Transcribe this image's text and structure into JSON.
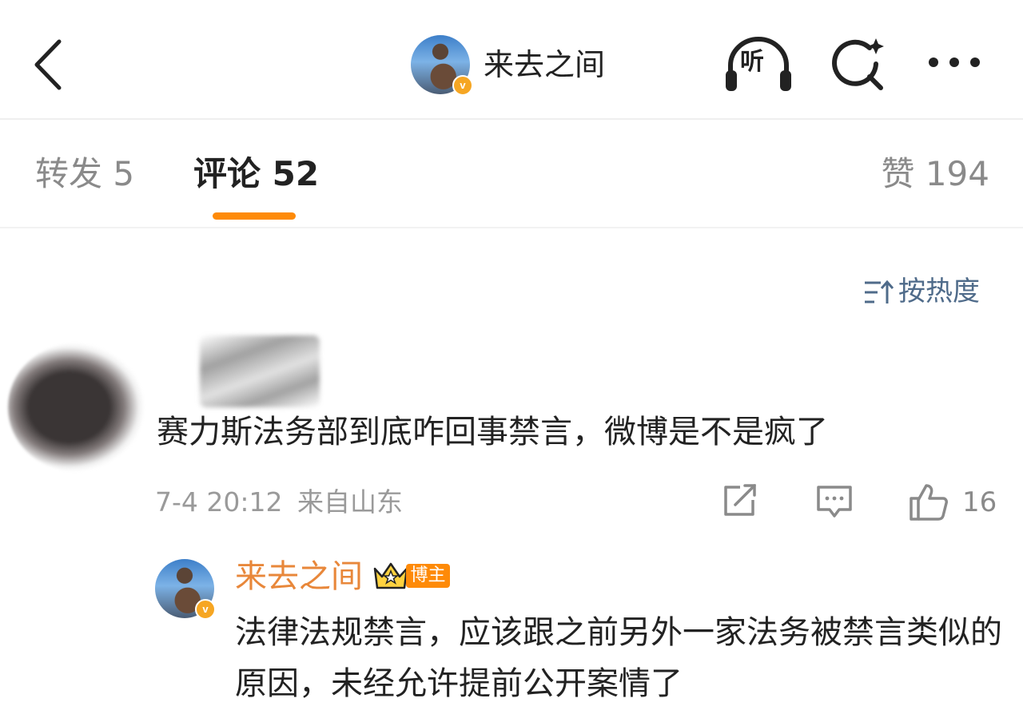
{
  "header": {
    "title": "来去之间",
    "listen_label": "听",
    "verified_badge": "v"
  },
  "tabs": [
    {
      "label": "转发 5"
    },
    {
      "label": "评论 52"
    },
    {
      "label": "赞 194"
    }
  ],
  "sort": {
    "label": "按热度"
  },
  "comment": {
    "text": "赛力斯法务部到底咋回事禁言，微博是不是疯了",
    "time": "7-4 20:12",
    "location": "来自山东",
    "like_count": "16"
  },
  "reply": {
    "author": "来去之间",
    "badge": "博主",
    "text": "法律法规禁言，应该跟之前另外一家法务被禁言类似的原因，未经允许提前公开案情了"
  },
  "colors": {
    "accent": "#fe8a08",
    "author_name": "#e8873a",
    "sort_text": "#4f6b8a",
    "muted": "#9a9a9a"
  }
}
